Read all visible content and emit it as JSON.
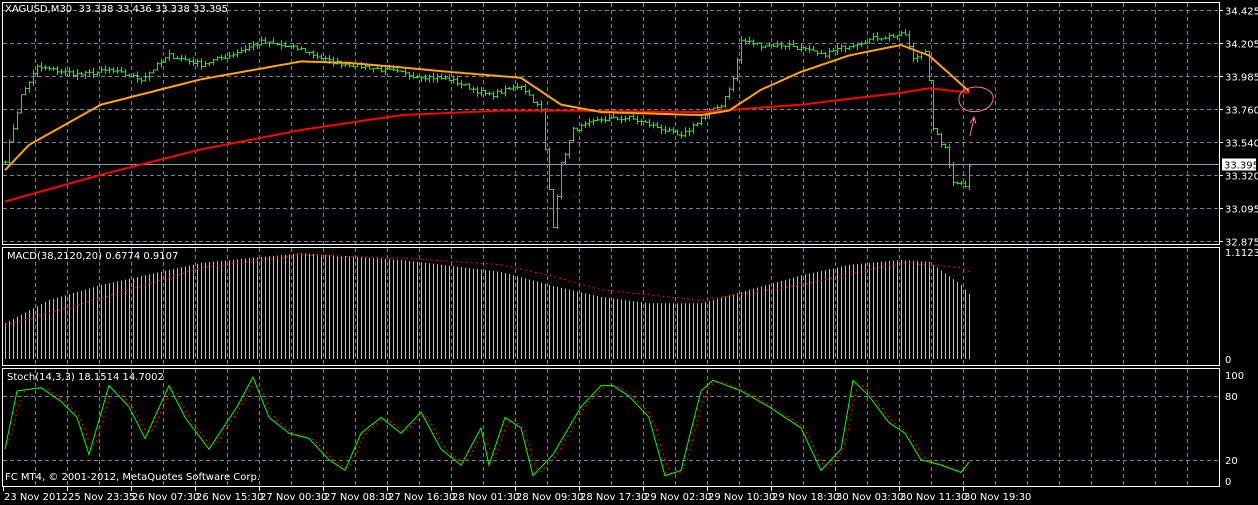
{
  "header": {
    "symbol_timeframe": "XAGUSD,M30",
    "ohlc": "33.338 33.436 33.338 33.395"
  },
  "macd_label": "MACD(38,2120,20) 0.6774 0.9107",
  "stoch_label": "Stoch(14,3,3) 18.1514 14.7002",
  "copyright": "FC MT4, © 2001-2012, MetaQuotes Software Corp.",
  "colors": {
    "candle": "#00ff00",
    "ma_fast": "#ffa500",
    "ma_slow": "#ff0000",
    "macd_hist": "#c0c0c0",
    "macd_signal": "#ff0000",
    "stoch_main": "#00ff00",
    "stoch_signal": "#ff0000",
    "annotation": "#ff69b4",
    "grid": "#708090"
  },
  "chart_data": [
    {
      "type": "line",
      "title": "XAGUSD,M30 price",
      "price_ticks": [
        "34.425",
        "34.205",
        "33.985",
        "33.760",
        "33.540",
        "33.320",
        "33.095",
        "32.875"
      ],
      "current_price": "33.395",
      "ylim": [
        32.875,
        34.425
      ],
      "x_labels": [
        "23 Nov 2012",
        "25 Nov 23:35",
        "26 Nov 07:30",
        "26 Nov 15:30",
        "27 Nov 00:30",
        "27 Nov 08:30",
        "27 Nov 16:30",
        "28 Nov 01:30",
        "28 Nov 09:30",
        "28 Nov 17:30",
        "29 Nov 02:30",
        "29 Nov 10:30",
        "29 Nov 18:30",
        "30 Nov 03:30",
        "30 Nov 11:30",
        "30 Nov 19:30"
      ],
      "bars": 242,
      "close_keypoints": [
        [
          0,
          33.42
        ],
        [
          4,
          33.85
        ],
        [
          8,
          34.04
        ],
        [
          19,
          33.99
        ],
        [
          26,
          34.02
        ],
        [
          34,
          33.96
        ],
        [
          41,
          34.12
        ],
        [
          49,
          34.06
        ],
        [
          56,
          34.12
        ],
        [
          64,
          34.21
        ],
        [
          74,
          34.16
        ],
        [
          81,
          34.08
        ],
        [
          91,
          34.04
        ],
        [
          101,
          33.99
        ],
        [
          111,
          33.96
        ],
        [
          121,
          33.85
        ],
        [
          129,
          33.92
        ],
        [
          134,
          33.75
        ],
        [
          136,
          33.22
        ],
        [
          137,
          32.98
        ],
        [
          139,
          33.39
        ],
        [
          142,
          33.62
        ],
        [
          149,
          33.69
        ],
        [
          156,
          33.7
        ],
        [
          164,
          33.63
        ],
        [
          169,
          33.57
        ],
        [
          174,
          33.7
        ],
        [
          179,
          33.79
        ],
        [
          182,
          33.96
        ],
        [
          184,
          34.22
        ],
        [
          189,
          34.19
        ],
        [
          196,
          34.19
        ],
        [
          204,
          34.12
        ],
        [
          211,
          34.19
        ],
        [
          218,
          34.24
        ],
        [
          225,
          34.26
        ],
        [
          227,
          34.09
        ],
        [
          230,
          34.16
        ],
        [
          231,
          33.96
        ],
        [
          232,
          33.62
        ],
        [
          235,
          33.49
        ],
        [
          237,
          33.28
        ],
        [
          240,
          33.25
        ],
        [
          241,
          33.39
        ]
      ],
      "ma_fast_keypoints": [
        [
          0,
          33.35
        ],
        [
          6,
          33.52
        ],
        [
          24,
          33.79
        ],
        [
          49,
          33.96
        ],
        [
          74,
          34.08
        ],
        [
          86,
          34.07
        ],
        [
          99,
          34.04
        ],
        [
          111,
          34.01
        ],
        [
          129,
          33.97
        ],
        [
          139,
          33.79
        ],
        [
          149,
          33.74
        ],
        [
          174,
          33.72
        ],
        [
          181,
          33.75
        ],
        [
          189,
          33.89
        ],
        [
          199,
          34.01
        ],
        [
          211,
          34.12
        ],
        [
          224,
          34.19
        ],
        [
          231,
          34.12
        ],
        [
          241,
          33.88
        ]
      ],
      "ma_slow_keypoints": [
        [
          0,
          33.14
        ],
        [
          24,
          33.32
        ],
        [
          49,
          33.49
        ],
        [
          74,
          33.62
        ],
        [
          99,
          33.72
        ],
        [
          124,
          33.75
        ],
        [
          139,
          33.75
        ],
        [
          174,
          33.74
        ],
        [
          199,
          33.79
        ],
        [
          224,
          33.87
        ],
        [
          231,
          33.9
        ],
        [
          241,
          33.87
        ]
      ]
    },
    {
      "type": "bar",
      "title": "MACD(38,2120,20)",
      "ylim": [
        0,
        1.1123
      ],
      "ticks": [
        "1.1123",
        "0"
      ],
      "hist_keypoints": [
        [
          0,
          0.374
        ],
        [
          11,
          0.614
        ],
        [
          24,
          0.77
        ],
        [
          49,
          1.0
        ],
        [
          74,
          1.1
        ],
        [
          99,
          1.03
        ],
        [
          124,
          0.905
        ],
        [
          136,
          0.77
        ],
        [
          149,
          0.645
        ],
        [
          161,
          0.58
        ],
        [
          174,
          0.58
        ],
        [
          186,
          0.72
        ],
        [
          199,
          0.87
        ],
        [
          211,
          0.98
        ],
        [
          224,
          1.03
        ],
        [
          231,
          1.01
        ],
        [
          239,
          0.77
        ],
        [
          241,
          0.6774
        ]
      ],
      "signal_keypoints": [
        [
          0,
          0.35
        ],
        [
          24,
          0.63
        ],
        [
          49,
          0.95
        ],
        [
          74,
          1.08
        ],
        [
          99,
          1.05
        ],
        [
          124,
          0.98
        ],
        [
          136,
          0.87
        ],
        [
          149,
          0.72
        ],
        [
          174,
          0.61
        ],
        [
          199,
          0.77
        ],
        [
          224,
          1.0
        ],
        [
          239,
          0.95
        ],
        [
          241,
          0.9107
        ]
      ]
    },
    {
      "type": "line",
      "title": "Stoch(14,3,3)",
      "ylim": [
        0,
        100
      ],
      "ticks": [
        "100",
        "80",
        "20",
        "0"
      ],
      "main_keypoints": [
        [
          0,
          30
        ],
        [
          3,
          85
        ],
        [
          9,
          88
        ],
        [
          14,
          75
        ],
        [
          18,
          60
        ],
        [
          21,
          25
        ],
        [
          26,
          90
        ],
        [
          31,
          70
        ],
        [
          35,
          40
        ],
        [
          41,
          90
        ],
        [
          45,
          60
        ],
        [
          51,
          30
        ],
        [
          58,
          70
        ],
        [
          62,
          98
        ],
        [
          66,
          60
        ],
        [
          71,
          45
        ],
        [
          76,
          40
        ],
        [
          81,
          20
        ],
        [
          85,
          10
        ],
        [
          89,
          45
        ],
        [
          94,
          60
        ],
        [
          99,
          45
        ],
        [
          104,
          65
        ],
        [
          109,
          30
        ],
        [
          114,
          15
        ],
        [
          119,
          50
        ],
        [
          121,
          15
        ],
        [
          125,
          60
        ],
        [
          129,
          50
        ],
        [
          132,
          5
        ],
        [
          137,
          25
        ],
        [
          144,
          70
        ],
        [
          149,
          90
        ],
        [
          152,
          90
        ],
        [
          156,
          80
        ],
        [
          161,
          60
        ],
        [
          165,
          5
        ],
        [
          169,
          10
        ],
        [
          174,
          85
        ],
        [
          177,
          95
        ],
        [
          184,
          85
        ],
        [
          191,
          70
        ],
        [
          199,
          50
        ],
        [
          204,
          10
        ],
        [
          209,
          30
        ],
        [
          212,
          95
        ],
        [
          216,
          80
        ],
        [
          221,
          55
        ],
        [
          225,
          45
        ],
        [
          229,
          20
        ],
        [
          234,
          15
        ],
        [
          239,
          8
        ],
        [
          241,
          18
        ]
      ]
    }
  ]
}
